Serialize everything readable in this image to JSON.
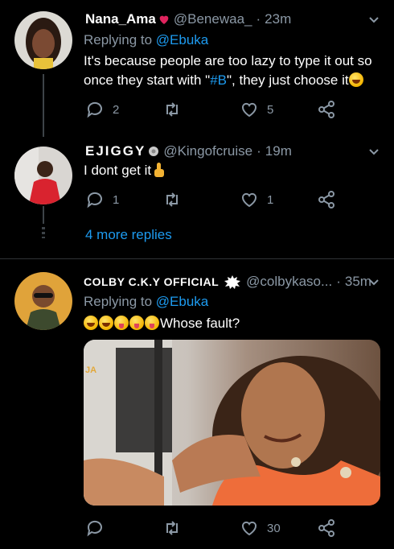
{
  "tweets": [
    {
      "name": "Nana_Ama",
      "handle": "@Benewaa_",
      "dot": "·",
      "time": "23m",
      "replying_prefix": "Replying to",
      "replying_to": "@Ebuka",
      "text_part1": "It's because people are too lazy to type it out so once they start with \"",
      "hashtag": "#B",
      "text_part2": "\", they just choose it",
      "reply_count": "2",
      "retweet_count": "",
      "like_count": "5"
    },
    {
      "name": "EJIGGY",
      "handle": "@Kingofcruise",
      "dot": "·",
      "time": "19m",
      "text": "I dont get it",
      "reply_count": "1",
      "retweet_count": "",
      "like_count": "1",
      "more_replies": "4 more replies"
    },
    {
      "name": "COLBY C.K.Y OFFICIAL",
      "handle": "@colbykaso...",
      "dot": "·",
      "time": "35m",
      "replying_prefix": "Replying to",
      "replying_to": "@Ebuka",
      "text": "Whose fault?",
      "media_overlay": "JA",
      "reply_count": "",
      "retweet_count": "",
      "like_count": "30"
    }
  ],
  "colors": {
    "background": "#000000",
    "link": "#1d9bf0",
    "secondary": "#8b98a5",
    "heart": "#e0245e"
  }
}
